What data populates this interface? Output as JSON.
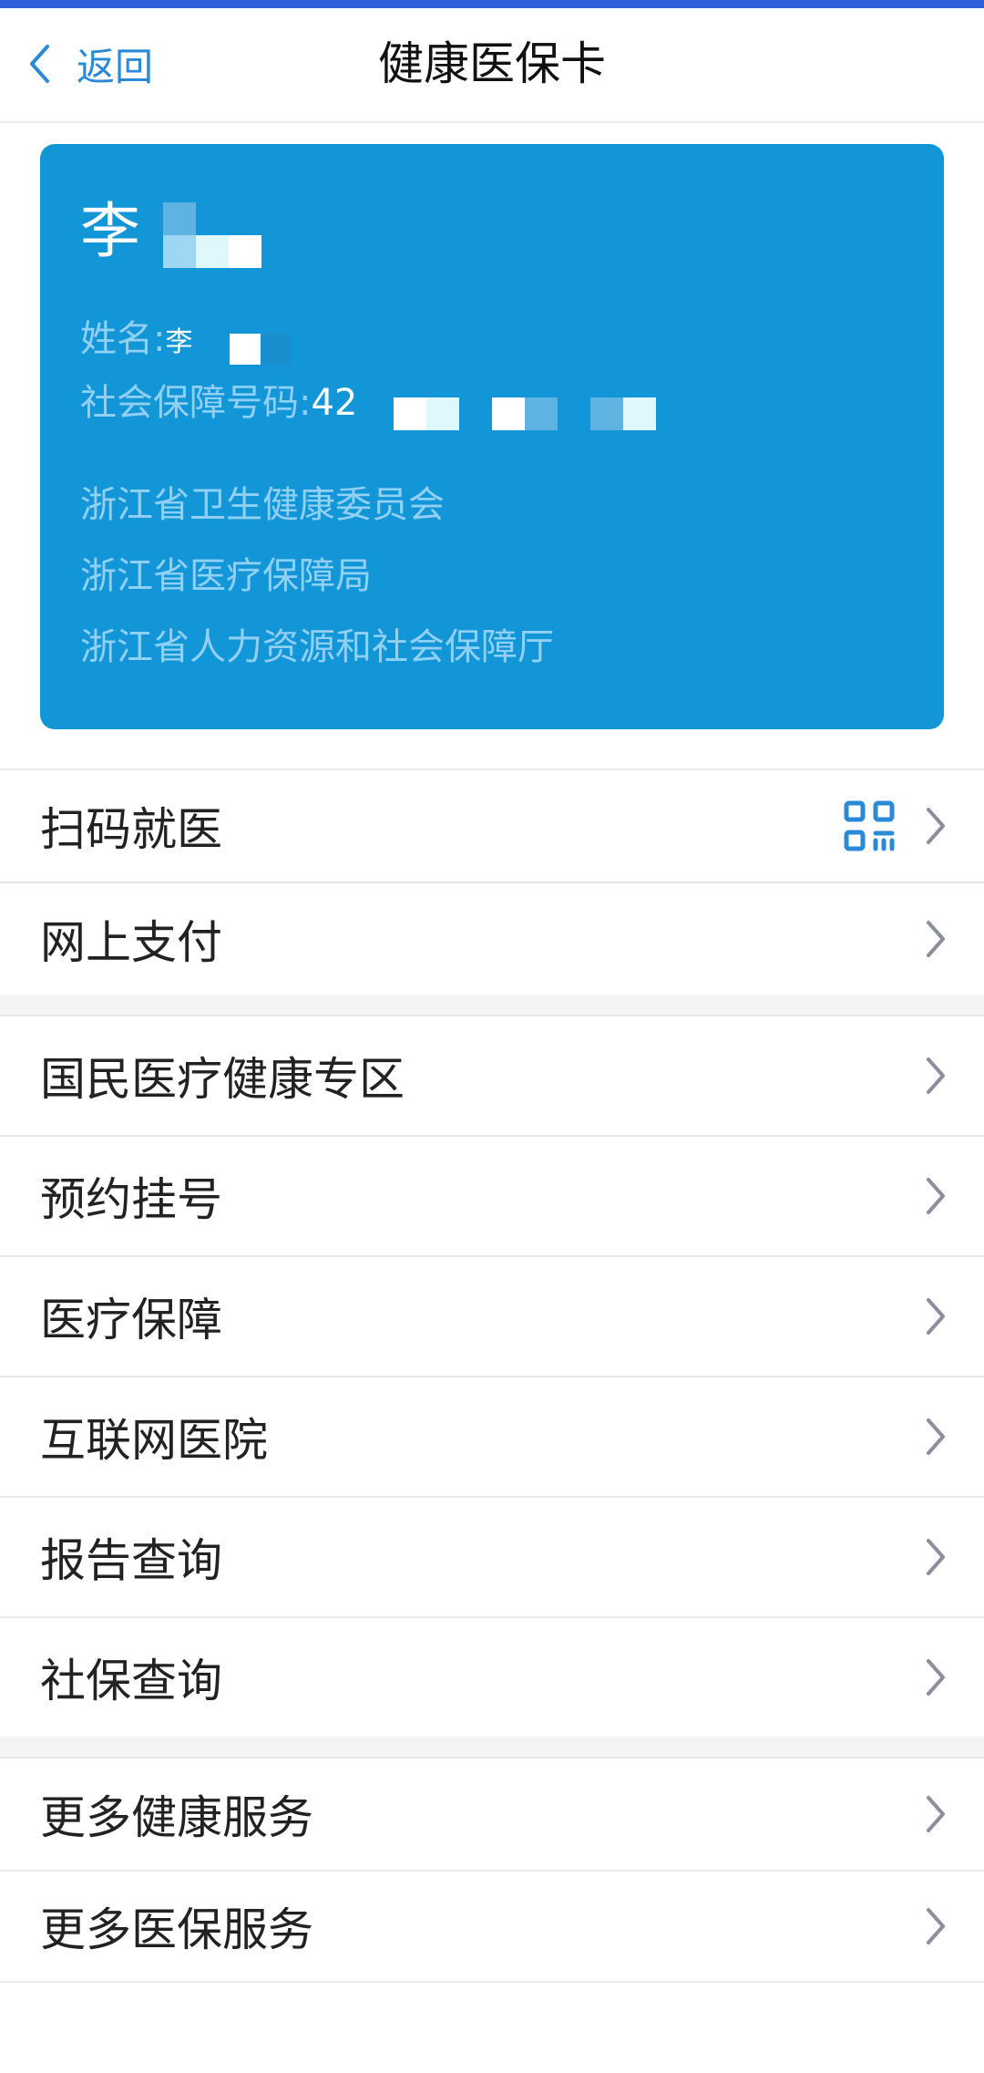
{
  "nav": {
    "back_label": "返回",
    "title": "健康医保卡"
  },
  "card": {
    "holder_name": "李",
    "name_label": "姓名:",
    "name_value": "李",
    "ssn_label": "社会保障号码:",
    "ssn_value": "42",
    "issuers": [
      "浙江省卫生健康委员会",
      "浙江省医疗保障局",
      "浙江省人力资源和社会保障厅"
    ]
  },
  "menu": {
    "group1": [
      {
        "label": "扫码就医"
      },
      {
        "label": "网上支付"
      }
    ],
    "group2": [
      {
        "label": "国民医疗健康专区"
      },
      {
        "label": "预约挂号"
      },
      {
        "label": "医疗保障"
      },
      {
        "label": "互联网医院"
      },
      {
        "label": "报告查询"
      },
      {
        "label": "社保查询"
      }
    ],
    "group3": [
      {
        "label": "更多健康服务"
      },
      {
        "label": "更多医保服务"
      }
    ]
  },
  "colors": {
    "accent": "#2f5fd8",
    "card_bg": "#1296d8",
    "link": "#2b8ad8"
  },
  "icons": {
    "back": "chevron-left-icon",
    "qr": "qr-code-icon",
    "arrow": "chevron-right-icon"
  }
}
